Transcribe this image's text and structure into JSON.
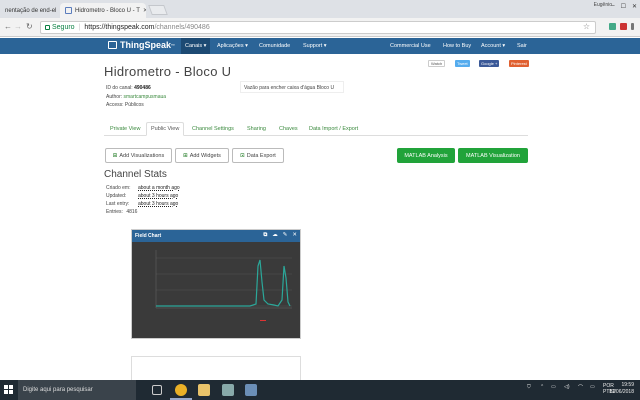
{
  "browser": {
    "tabs": [
      {
        "title": "nentação de end-el",
        "active": false
      },
      {
        "title": "Hidrometro - Bloco U - T",
        "active": true
      }
    ],
    "user": "Eugênio",
    "secure_label": "Seguro",
    "url_host": "https://thingspeak.com",
    "url_path": "/channels/490486"
  },
  "nav": {
    "logo": "ThingSpeak",
    "items": [
      "Canais ▾",
      "Aplicações ▾",
      "Comunidade",
      "Support ▾"
    ],
    "right_items": [
      "Commercial Use",
      "How to Buy",
      "Account ▾",
      "Sair"
    ]
  },
  "share": {
    "watch": "Watch",
    "tweet": "Tweet",
    "google": "Google +",
    "pinterest": "Pinterest"
  },
  "channel": {
    "title": "Hidrometro - Bloco U",
    "id_label": "ID do canal:",
    "id_value": "490486",
    "author_label": "Author:",
    "author_value": "smartcampusmaua",
    "access_label": "Access:",
    "access_value": "Públicos",
    "description": "Vazão para encher caixa d'água Bloco U"
  },
  "page_tabs": [
    "Private View",
    "Public View",
    "Channel Settings",
    "Sharing",
    "Chaves",
    "Data Import / Export"
  ],
  "buttons": {
    "add_visualizations": "Add Visualizations",
    "add_widgets": "Add Widgets",
    "data_export": "Data Export",
    "matlab_analysis": "MATLAB Analysis",
    "matlab_visualization": "MATLAB Visualization"
  },
  "stats": {
    "title": "Channel Stats",
    "created_label": "Criado em:",
    "created_value": "about a month ago",
    "updated_label": "Updated:",
    "updated_value": "about 3 hours ago",
    "last_entry_label": "Last entry:",
    "last_entry_value": "about 3 hours ago",
    "entries_label": "Entries:",
    "entries_value": "4816"
  },
  "widget": {
    "title": "Field Chart"
  },
  "taskbar": {
    "search_placeholder": "Digite aqui para pesquisar",
    "lang": "POR",
    "lang2": "PTB2",
    "time": "19:59",
    "date": "11/06/2018"
  },
  "colors": {
    "nav_blue": "#2b6497",
    "green": "#21a33a",
    "chart_line": "#2ba89a",
    "chart_bg": "#333333"
  }
}
